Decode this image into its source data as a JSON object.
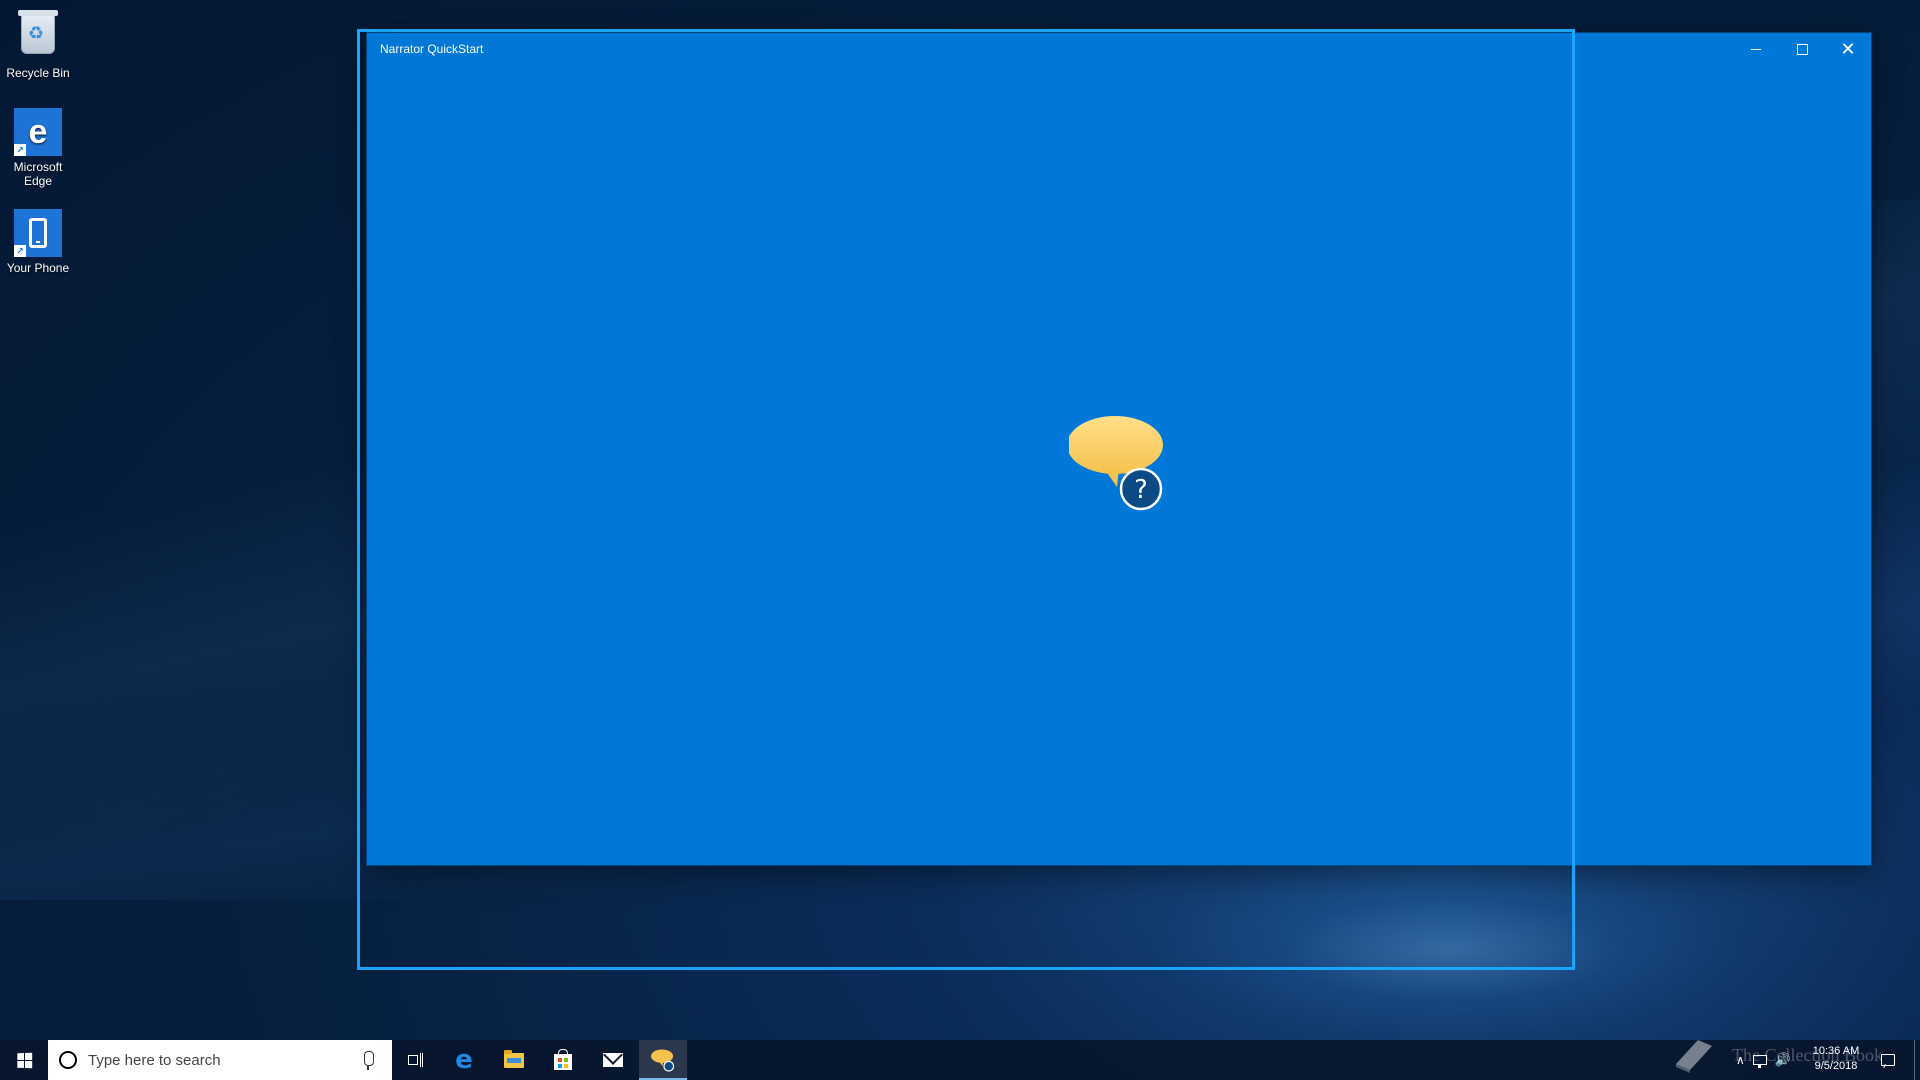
{
  "desktop": {
    "icons": [
      {
        "label": "Recycle Bin",
        "icon": "recycle-bin-icon"
      },
      {
        "label": "Microsoft Edge",
        "icon": "edge-icon"
      },
      {
        "label": "Your Phone",
        "icon": "phone-icon"
      }
    ]
  },
  "window": {
    "title": "Narrator QuickStart",
    "background_color": "#0078d7",
    "controls": {
      "minimize_icon": "minimize-icon",
      "maximize_icon": "maximize-icon",
      "close_icon": "close-icon"
    },
    "splash_icon": "narrator-speech-bubble-icon",
    "splash_badge_glyph": "?"
  },
  "focus_highlight_color": "#1aa3ff",
  "taskbar": {
    "search_placeholder": "Type here to search",
    "pinned": [
      {
        "name": "task-view",
        "icon": "task-view-icon"
      },
      {
        "name": "microsoft-edge",
        "icon": "edge-icon"
      },
      {
        "name": "file-explorer",
        "icon": "folder-icon"
      },
      {
        "name": "microsoft-store",
        "icon": "store-icon"
      },
      {
        "name": "mail",
        "icon": "mail-icon"
      },
      {
        "name": "narrator-quickstart",
        "icon": "narrator-icon",
        "active": true
      }
    ],
    "tray": {
      "watermark": "The Collection Book",
      "time": "10:36 AM",
      "date": "9/5/2018"
    }
  },
  "glyphs": {
    "edge_letter": "e",
    "recycle_symbol": "♻",
    "shortcut_arrow": "↗",
    "close_symbol": "✕",
    "tray_chevron": "∧",
    "tray_volume": "🔊"
  }
}
